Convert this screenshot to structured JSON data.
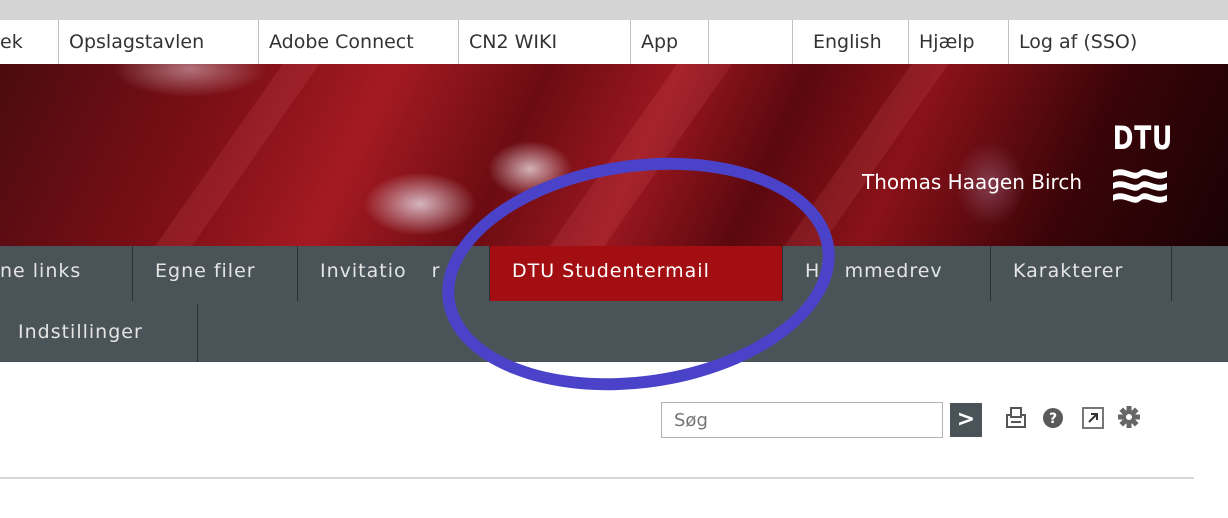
{
  "top_links": [
    {
      "label": "ek"
    },
    {
      "label": "Opslagstavlen"
    },
    {
      "label": "Adobe Connect"
    },
    {
      "label": "CN2 WIKI"
    },
    {
      "label": "App"
    },
    {
      "label": "English"
    },
    {
      "label": "Hjælp"
    },
    {
      "label": "Log af (SSO)"
    }
  ],
  "banner": {
    "user_name": "Thomas Haagen Birch",
    "logo_text": "DTU"
  },
  "nav": {
    "row1": [
      {
        "label": "ne links"
      },
      {
        "label": "Egne filer"
      },
      {
        "label": "Invitatio"
      },
      {
        "label": "r"
      },
      {
        "label": "DTU Studentermail",
        "active": true
      },
      {
        "label": "Hj"
      },
      {
        "label": "mmedrev"
      },
      {
        "label": "Karakterer"
      }
    ],
    "row2": [
      {
        "label": "Indstillinger"
      }
    ]
  },
  "search": {
    "placeholder": "Søg",
    "button_glyph": ">"
  },
  "toolbar": {
    "icons": [
      "print-icon",
      "help-icon",
      "external-link-icon",
      "settings-icon"
    ]
  },
  "colors": {
    "nav_bg": "#4a5458",
    "active_tab": "#a30e13",
    "annotation_circle": "#4a43c9"
  }
}
